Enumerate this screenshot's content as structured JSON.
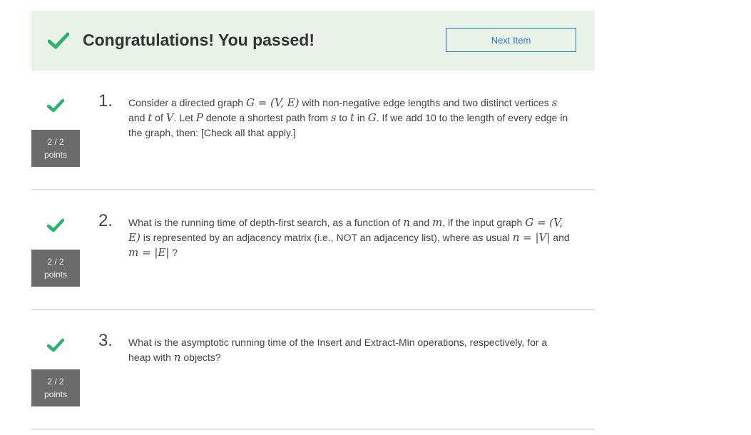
{
  "banner": {
    "title": "Congratulations! You passed!",
    "next_button": "Next Item",
    "check_icon": "check-icon"
  },
  "questions": [
    {
      "number": "1.",
      "points_value": "2 / 2",
      "points_label": "points",
      "text_parts": [
        "Consider a directed graph ",
        "G = (V, E)",
        " with non-negative edge lengths and two distinct vertices ",
        "s",
        " and ",
        "t",
        " of ",
        "V",
        ". Let ",
        "P",
        " denote a shortest path from ",
        "s",
        " to ",
        "t",
        " in ",
        "G",
        ". If we add 10 to the length of every edge in the graph, then: [Check all that apply.]"
      ]
    },
    {
      "number": "2.",
      "points_value": "2 / 2",
      "points_label": "points",
      "text_parts": [
        "What is the running time of depth-first search, as a function of ",
        "n",
        " and ",
        "m",
        ", if the input graph ",
        "G = (V, E)",
        " is represented by an adjacency matrix (i.e., NOT an adjacency list), where as usual ",
        "n = |V|",
        " and ",
        "m = |E|",
        " ?"
      ]
    },
    {
      "number": "3.",
      "points_value": "2 / 2",
      "points_label": "points",
      "text_parts": [
        "What is the asymptotic running time of the Insert and Extract-Min operations, respectively, for a heap with ",
        "n",
        " objects?"
      ]
    }
  ],
  "colors": {
    "banner_bg": "#e9f3e8",
    "check_green": "#2eb36b",
    "button_blue": "#2a73cc",
    "points_bg": "#6b6b6b"
  }
}
